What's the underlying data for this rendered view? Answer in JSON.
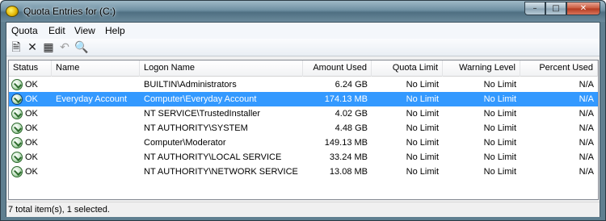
{
  "window": {
    "title": "Quota Entries for  (C:)",
    "controls": [
      "minimize",
      "maximize",
      "close"
    ]
  },
  "menu": {
    "items": [
      "Quota",
      "Edit",
      "View",
      "Help"
    ]
  },
  "toolbar": {
    "icons": [
      "new-entry-icon",
      "delete-icon",
      "properties-icon",
      "undo-icon",
      "find-icon"
    ]
  },
  "table": {
    "columns": [
      "Status",
      "Name",
      "Logon Name",
      "Amount Used",
      "Quota Limit",
      "Warning Level",
      "Percent Used"
    ],
    "rows": [
      {
        "status": "OK",
        "name": "",
        "logon": "BUILTIN\\Administrators",
        "amount": "6.24 GB",
        "quota": "No Limit",
        "warning": "No Limit",
        "percent": "N/A",
        "selected": false
      },
      {
        "status": "OK",
        "name": "Everyday Account",
        "logon": "Computer\\Everyday Account",
        "amount": "174.13 MB",
        "quota": "No Limit",
        "warning": "No Limit",
        "percent": "N/A",
        "selected": true
      },
      {
        "status": "OK",
        "name": "",
        "logon": "NT SERVICE\\TrustedInstaller",
        "amount": "4.02 GB",
        "quota": "No Limit",
        "warning": "No Limit",
        "percent": "N/A",
        "selected": false
      },
      {
        "status": "OK",
        "name": "",
        "logon": "NT AUTHORITY\\SYSTEM",
        "amount": "4.48 GB",
        "quota": "No Limit",
        "warning": "No Limit",
        "percent": "N/A",
        "selected": false
      },
      {
        "status": "OK",
        "name": "",
        "logon": "Computer\\Moderator",
        "amount": "149.13 MB",
        "quota": "No Limit",
        "warning": "No Limit",
        "percent": "N/A",
        "selected": false
      },
      {
        "status": "OK",
        "name": "",
        "logon": "NT AUTHORITY\\LOCAL SERVICE",
        "amount": "33.24 MB",
        "quota": "No Limit",
        "warning": "No Limit",
        "percent": "N/A",
        "selected": false
      },
      {
        "status": "OK",
        "name": "",
        "logon": "NT AUTHORITY\\NETWORK SERVICE",
        "amount": "13.08 MB",
        "quota": "No Limit",
        "warning": "No Limit",
        "percent": "N/A",
        "selected": false
      }
    ]
  },
  "statusbar": {
    "text": "7 total item(s), 1 selected."
  },
  "colors": {
    "selection": "#3399ff",
    "titlebar": "#6e8fa2"
  }
}
